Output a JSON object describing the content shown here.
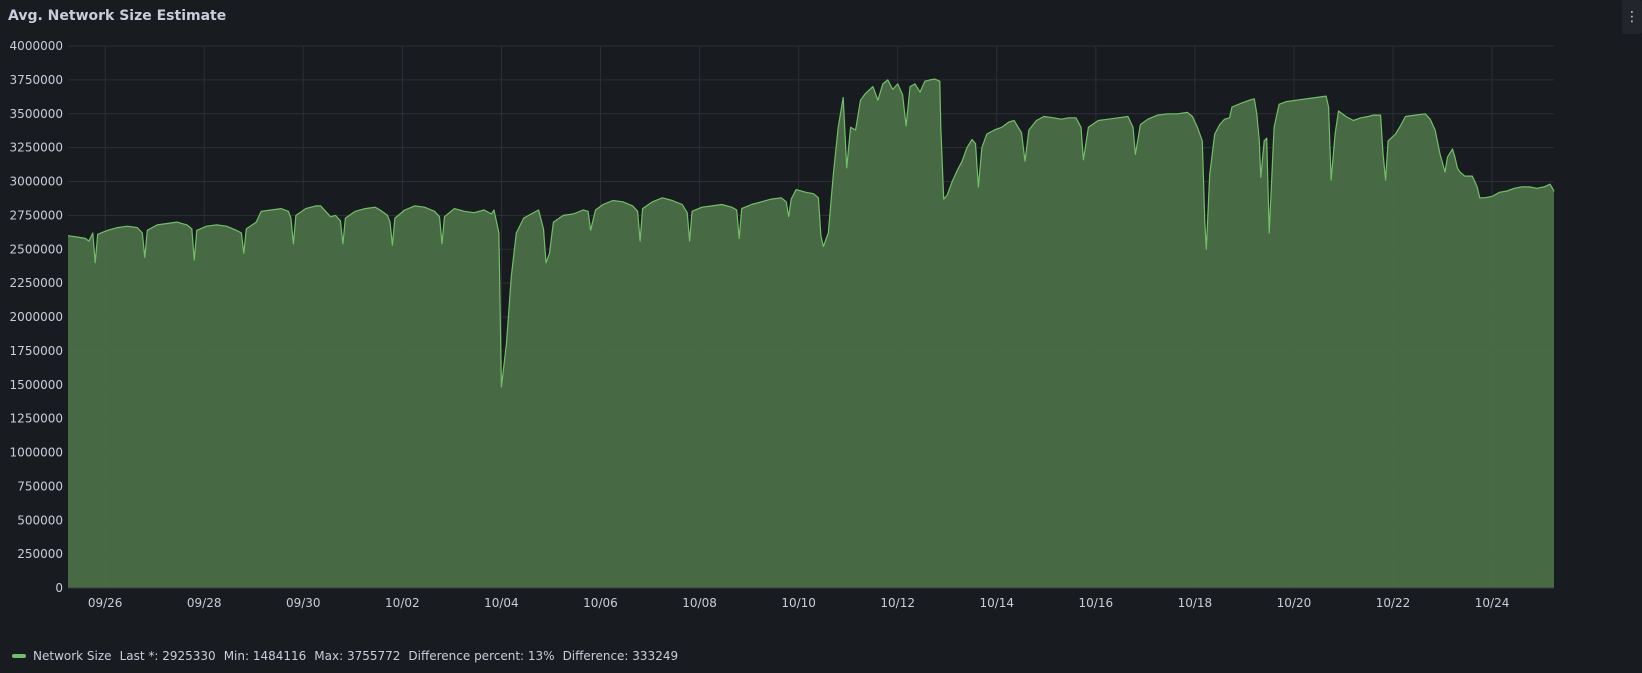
{
  "panel": {
    "title": "Avg. Network Size Estimate",
    "menu_icon": "vertical-ellipsis-icon"
  },
  "legend": {
    "series_name": "Network Size",
    "last": "Last *: 2925330",
    "min": "Min: 1484116",
    "max": "Max: 3755772",
    "diff_percent": "Difference percent: 13%",
    "diff": "Difference: 333249"
  },
  "colors": {
    "line": "#73bf69",
    "fill": "#4a6e46",
    "grid": "#2c3035",
    "background": "#181b1f"
  },
  "chart_data": {
    "type": "area",
    "title": "Avg. Network Size Estimate",
    "xlabel": "",
    "ylabel": "",
    "ylim": [
      0,
      4000000
    ],
    "yticks": [
      0,
      250000,
      500000,
      750000,
      1000000,
      1250000,
      1500000,
      1750000,
      2000000,
      2250000,
      2500000,
      2750000,
      3000000,
      3250000,
      3500000,
      3750000,
      4000000
    ],
    "x_tick_labels": [
      "09/26",
      "09/28",
      "09/30",
      "10/02",
      "10/04",
      "10/06",
      "10/08",
      "10/10",
      "10/12",
      "10/14",
      "10/16",
      "10/18",
      "10/20",
      "10/22",
      "10/24"
    ],
    "x_range_days": [
      0,
      30
    ],
    "grid": true,
    "legend_position": "bottom-left",
    "series": [
      {
        "name": "Network Size",
        "points": [
          [
            0.0,
            2600000
          ],
          [
            0.2,
            2590000
          ],
          [
            0.35,
            2580000
          ],
          [
            0.42,
            2560000
          ],
          [
            0.5,
            2620000
          ],
          [
            0.55,
            2400000
          ],
          [
            0.6,
            2610000
          ],
          [
            0.8,
            2640000
          ],
          [
            1.0,
            2660000
          ],
          [
            1.2,
            2670000
          ],
          [
            1.4,
            2660000
          ],
          [
            1.5,
            2620000
          ],
          [
            1.55,
            2440000
          ],
          [
            1.6,
            2640000
          ],
          [
            1.8,
            2680000
          ],
          [
            2.0,
            2690000
          ],
          [
            2.2,
            2700000
          ],
          [
            2.4,
            2680000
          ],
          [
            2.5,
            2650000
          ],
          [
            2.55,
            2420000
          ],
          [
            2.6,
            2640000
          ],
          [
            2.8,
            2670000
          ],
          [
            3.0,
            2680000
          ],
          [
            3.2,
            2670000
          ],
          [
            3.4,
            2640000
          ],
          [
            3.5,
            2620000
          ],
          [
            3.55,
            2470000
          ],
          [
            3.6,
            2650000
          ],
          [
            3.8,
            2700000
          ],
          [
            3.9,
            2780000
          ],
          [
            4.1,
            2790000
          ],
          [
            4.3,
            2800000
          ],
          [
            4.45,
            2780000
          ],
          [
            4.5,
            2730000
          ],
          [
            4.55,
            2540000
          ],
          [
            4.6,
            2750000
          ],
          [
            4.8,
            2800000
          ],
          [
            5.0,
            2820000
          ],
          [
            5.1,
            2820000
          ],
          [
            5.2,
            2780000
          ],
          [
            5.3,
            2740000
          ],
          [
            5.4,
            2750000
          ],
          [
            5.5,
            2710000
          ],
          [
            5.55,
            2540000
          ],
          [
            5.6,
            2730000
          ],
          [
            5.8,
            2780000
          ],
          [
            6.0,
            2800000
          ],
          [
            6.2,
            2810000
          ],
          [
            6.3,
            2790000
          ],
          [
            6.45,
            2750000
          ],
          [
            6.5,
            2700000
          ],
          [
            6.55,
            2530000
          ],
          [
            6.6,
            2730000
          ],
          [
            6.8,
            2790000
          ],
          [
            7.0,
            2820000
          ],
          [
            7.2,
            2810000
          ],
          [
            7.4,
            2780000
          ],
          [
            7.5,
            2740000
          ],
          [
            7.55,
            2540000
          ],
          [
            7.6,
            2740000
          ],
          [
            7.8,
            2800000
          ],
          [
            8.0,
            2780000
          ],
          [
            8.2,
            2770000
          ],
          [
            8.4,
            2790000
          ],
          [
            8.55,
            2760000
          ],
          [
            8.6,
            2790000
          ],
          [
            8.7,
            2620000
          ],
          [
            8.75,
            1484116
          ],
          [
            8.85,
            1800000
          ],
          [
            8.95,
            2300000
          ],
          [
            9.05,
            2620000
          ],
          [
            9.2,
            2730000
          ],
          [
            9.35,
            2760000
          ],
          [
            9.5,
            2790000
          ],
          [
            9.6,
            2650000
          ],
          [
            9.65,
            2400000
          ],
          [
            9.72,
            2470000
          ],
          [
            9.8,
            2700000
          ],
          [
            10.0,
            2750000
          ],
          [
            10.2,
            2760000
          ],
          [
            10.4,
            2790000
          ],
          [
            10.5,
            2780000
          ],
          [
            10.55,
            2640000
          ],
          [
            10.65,
            2790000
          ],
          [
            10.8,
            2830000
          ],
          [
            11.0,
            2860000
          ],
          [
            11.2,
            2850000
          ],
          [
            11.4,
            2820000
          ],
          [
            11.5,
            2780000
          ],
          [
            11.55,
            2560000
          ],
          [
            11.6,
            2800000
          ],
          [
            11.8,
            2850000
          ],
          [
            12.0,
            2880000
          ],
          [
            12.2,
            2860000
          ],
          [
            12.4,
            2830000
          ],
          [
            12.5,
            2770000
          ],
          [
            12.55,
            2560000
          ],
          [
            12.6,
            2780000
          ],
          [
            12.8,
            2810000
          ],
          [
            13.0,
            2820000
          ],
          [
            13.2,
            2830000
          ],
          [
            13.4,
            2810000
          ],
          [
            13.5,
            2790000
          ],
          [
            13.55,
            2580000
          ],
          [
            13.6,
            2800000
          ],
          [
            13.8,
            2830000
          ],
          [
            14.0,
            2850000
          ],
          [
            14.2,
            2870000
          ],
          [
            14.4,
            2880000
          ],
          [
            14.5,
            2850000
          ],
          [
            14.55,
            2740000
          ],
          [
            14.6,
            2870000
          ],
          [
            14.7,
            2940000
          ],
          [
            14.9,
            2920000
          ],
          [
            15.05,
            2910000
          ],
          [
            15.15,
            2880000
          ],
          [
            15.2,
            2600000
          ],
          [
            15.25,
            2520000
          ],
          [
            15.35,
            2620000
          ],
          [
            15.45,
            3050000
          ],
          [
            15.55,
            3400000
          ],
          [
            15.65,
            3620000
          ],
          [
            15.72,
            3100000
          ],
          [
            15.8,
            3400000
          ],
          [
            15.9,
            3380000
          ],
          [
            16.0,
            3600000
          ],
          [
            16.1,
            3650000
          ],
          [
            16.25,
            3700000
          ],
          [
            16.35,
            3600000
          ],
          [
            16.45,
            3720000
          ],
          [
            16.55,
            3750000
          ],
          [
            16.65,
            3680000
          ],
          [
            16.75,
            3720000
          ],
          [
            16.85,
            3640000
          ],
          [
            16.92,
            3410000
          ],
          [
            17.0,
            3700000
          ],
          [
            17.1,
            3720000
          ],
          [
            17.2,
            3660000
          ],
          [
            17.3,
            3740000
          ],
          [
            17.4,
            3750000
          ],
          [
            17.5,
            3755772
          ],
          [
            17.6,
            3740000
          ],
          [
            17.62,
            3400000
          ],
          [
            17.68,
            2870000
          ],
          [
            17.75,
            2900000
          ],
          [
            17.85,
            3000000
          ],
          [
            17.95,
            3080000
          ],
          [
            18.05,
            3150000
          ],
          [
            18.15,
            3250000
          ],
          [
            18.25,
            3310000
          ],
          [
            18.32,
            3280000
          ],
          [
            18.38,
            2960000
          ],
          [
            18.45,
            3250000
          ],
          [
            18.55,
            3350000
          ],
          [
            18.7,
            3380000
          ],
          [
            18.85,
            3400000
          ],
          [
            19.0,
            3440000
          ],
          [
            19.1,
            3450000
          ],
          [
            19.25,
            3360000
          ],
          [
            19.32,
            3150000
          ],
          [
            19.4,
            3380000
          ],
          [
            19.55,
            3450000
          ],
          [
            19.7,
            3480000
          ],
          [
            19.9,
            3470000
          ],
          [
            20.05,
            3460000
          ],
          [
            20.2,
            3470000
          ],
          [
            20.35,
            3470000
          ],
          [
            20.45,
            3400000
          ],
          [
            20.5,
            3160000
          ],
          [
            20.6,
            3400000
          ],
          [
            20.8,
            3450000
          ],
          [
            21.0,
            3460000
          ],
          [
            21.2,
            3470000
          ],
          [
            21.4,
            3480000
          ],
          [
            21.5,
            3400000
          ],
          [
            21.55,
            3200000
          ],
          [
            21.65,
            3420000
          ],
          [
            21.8,
            3460000
          ],
          [
            22.0,
            3490000
          ],
          [
            22.2,
            3500000
          ],
          [
            22.4,
            3500000
          ],
          [
            22.6,
            3510000
          ],
          [
            22.7,
            3480000
          ],
          [
            22.8,
            3400000
          ],
          [
            22.9,
            3300000
          ],
          [
            22.95,
            2700000
          ],
          [
            22.98,
            2500000
          ],
          [
            23.05,
            3050000
          ],
          [
            23.15,
            3350000
          ],
          [
            23.25,
            3420000
          ],
          [
            23.35,
            3460000
          ],
          [
            23.45,
            3470000
          ],
          [
            23.5,
            3550000
          ],
          [
            23.7,
            3580000
          ],
          [
            23.85,
            3600000
          ],
          [
            23.95,
            3610000
          ],
          [
            24.0,
            3500000
          ],
          [
            24.05,
            3300000
          ],
          [
            24.08,
            3030000
          ],
          [
            24.15,
            3300000
          ],
          [
            24.2,
            3320000
          ],
          [
            24.25,
            2620000
          ],
          [
            24.35,
            3400000
          ],
          [
            24.45,
            3570000
          ],
          [
            24.6,
            3590000
          ],
          [
            24.8,
            3600000
          ],
          [
            25.0,
            3610000
          ],
          [
            25.2,
            3620000
          ],
          [
            25.4,
            3630000
          ],
          [
            25.45,
            3550000
          ],
          [
            25.5,
            3010000
          ],
          [
            25.58,
            3350000
          ],
          [
            25.65,
            3520000
          ],
          [
            25.8,
            3480000
          ],
          [
            25.95,
            3450000
          ],
          [
            26.1,
            3470000
          ],
          [
            26.25,
            3480000
          ],
          [
            26.35,
            3490000
          ],
          [
            26.5,
            3490000
          ],
          [
            26.55,
            3200000
          ],
          [
            26.6,
            3010000
          ],
          [
            26.65,
            3300000
          ],
          [
            26.8,
            3350000
          ],
          [
            26.9,
            3410000
          ],
          [
            27.0,
            3480000
          ],
          [
            27.2,
            3490000
          ],
          [
            27.4,
            3500000
          ],
          [
            27.5,
            3460000
          ],
          [
            27.6,
            3380000
          ],
          [
            27.7,
            3200000
          ],
          [
            27.8,
            3070000
          ],
          [
            27.85,
            3180000
          ],
          [
            27.95,
            3240000
          ],
          [
            28.0,
            3180000
          ],
          [
            28.05,
            3100000
          ],
          [
            28.1,
            3070000
          ],
          [
            28.2,
            3040000
          ],
          [
            28.35,
            3040000
          ],
          [
            28.45,
            2960000
          ],
          [
            28.5,
            2880000
          ],
          [
            28.6,
            2880000
          ],
          [
            28.75,
            2890000
          ],
          [
            28.9,
            2920000
          ],
          [
            29.05,
            2930000
          ],
          [
            29.2,
            2950000
          ],
          [
            29.35,
            2960000
          ],
          [
            29.5,
            2960000
          ],
          [
            29.65,
            2950000
          ],
          [
            29.8,
            2960000
          ],
          [
            29.92,
            2980000
          ],
          [
            29.97,
            2950000
          ],
          [
            30.0,
            2925330
          ]
        ]
      }
    ]
  }
}
